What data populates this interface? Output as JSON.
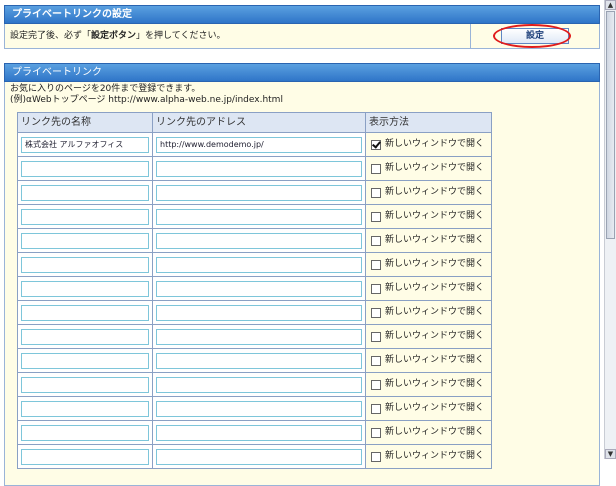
{
  "section1": {
    "header": "プライベートリンクの設定",
    "notice_prefix": "設定完了後、必ず「",
    "notice_bold": "設定ボタン",
    "notice_suffix": "」を押してください。",
    "set_button": "設定"
  },
  "section2": {
    "header": "プライベートリンク",
    "desc_line1": "お気に入りのページを20件まで登録できます。",
    "desc_line2": "(例)αWebトップページ http://www.alpha-web.ne.jp/index.html"
  },
  "table": {
    "col_name": "リンク先の名称",
    "col_address": "リンク先のアドレス",
    "col_display": "表示方法",
    "rows": [
      {
        "name": "株式会社 アルファオフィス",
        "address": "http://www.demodemo.jp/",
        "checked": true,
        "label": "新しいウィンドウで開く"
      },
      {
        "name": "",
        "address": "",
        "checked": false,
        "label": "新しいウィンドウで開く"
      },
      {
        "name": "",
        "address": "",
        "checked": false,
        "label": "新しいウィンドウで開く"
      },
      {
        "name": "",
        "address": "",
        "checked": false,
        "label": "新しいウィンドウで開く"
      },
      {
        "name": "",
        "address": "",
        "checked": false,
        "label": "新しいウィンドウで開く"
      },
      {
        "name": "",
        "address": "",
        "checked": false,
        "label": "新しいウィンドウで開く"
      },
      {
        "name": "",
        "address": "",
        "checked": false,
        "label": "新しいウィンドウで開く"
      },
      {
        "name": "",
        "address": "",
        "checked": false,
        "label": "新しいウィンドウで開く"
      },
      {
        "name": "",
        "address": "",
        "checked": false,
        "label": "新しいウィンドウで開く"
      },
      {
        "name": "",
        "address": "",
        "checked": false,
        "label": "新しいウィンドウで開く"
      },
      {
        "name": "",
        "address": "",
        "checked": false,
        "label": "新しいウィンドウで開く"
      },
      {
        "name": "",
        "address": "",
        "checked": false,
        "label": "新しいウィンドウで開く"
      },
      {
        "name": "",
        "address": "",
        "checked": false,
        "label": "新しいウィンドウで開く"
      },
      {
        "name": "",
        "address": "",
        "checked": false,
        "label": "新しいウィンドウで開く"
      }
    ]
  },
  "colors": {
    "header_blue": "#2f75c8",
    "note_bg": "#fffde6",
    "highlight_ring": "#e01b1b"
  },
  "icons": {
    "checkbox_checked": "checkbox-checked-icon",
    "checkbox_unchecked": "checkbox-unchecked-icon",
    "scroll_up": "scroll-up-arrow-icon",
    "scroll_down": "scroll-down-arrow-icon"
  }
}
